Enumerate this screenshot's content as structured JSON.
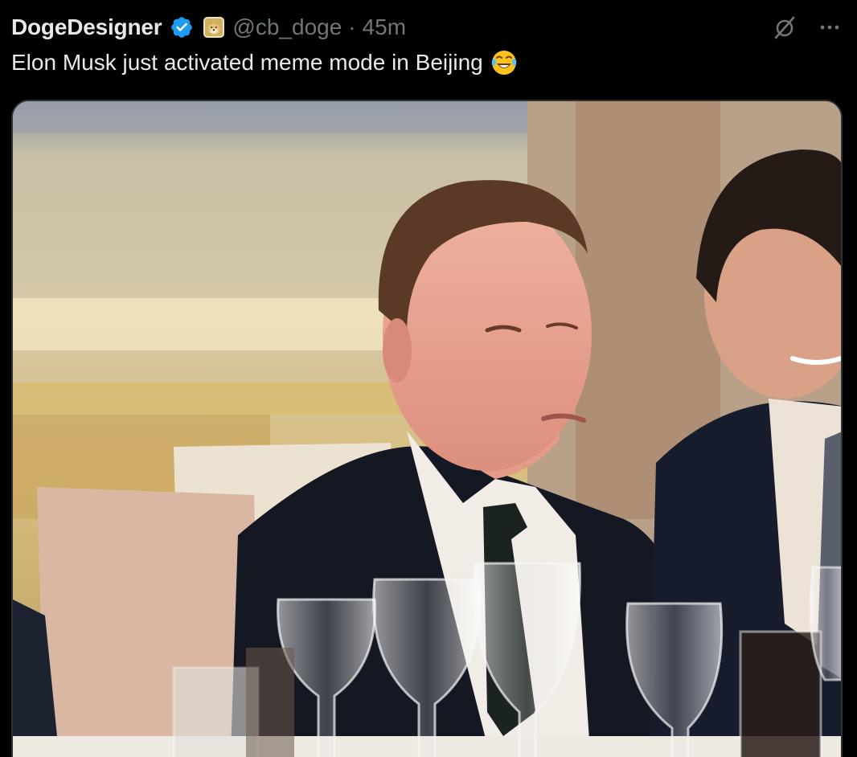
{
  "author": {
    "display_name": "DogeDesigner",
    "handle": "@cb_doge",
    "separator": "·",
    "time_ago": "45m",
    "verified_icon": "verified-badge-icon",
    "affiliate_icon": "doge-affiliate-badge-icon"
  },
  "actions": {
    "grok_icon": "grok-icon",
    "more_icon": "more-options-icon"
  },
  "tweet": {
    "text": "Elon Musk just activated meme mode in Beijing",
    "emoji": "face-with-tears-of-joy-emoji"
  },
  "media": {
    "type": "video-still"
  },
  "colors": {
    "background": "#000000",
    "primary_text": "#e7e9ea",
    "secondary_text": "#71767b",
    "verified_blue": "#1d9bf0",
    "media_border": "#2f3336"
  }
}
